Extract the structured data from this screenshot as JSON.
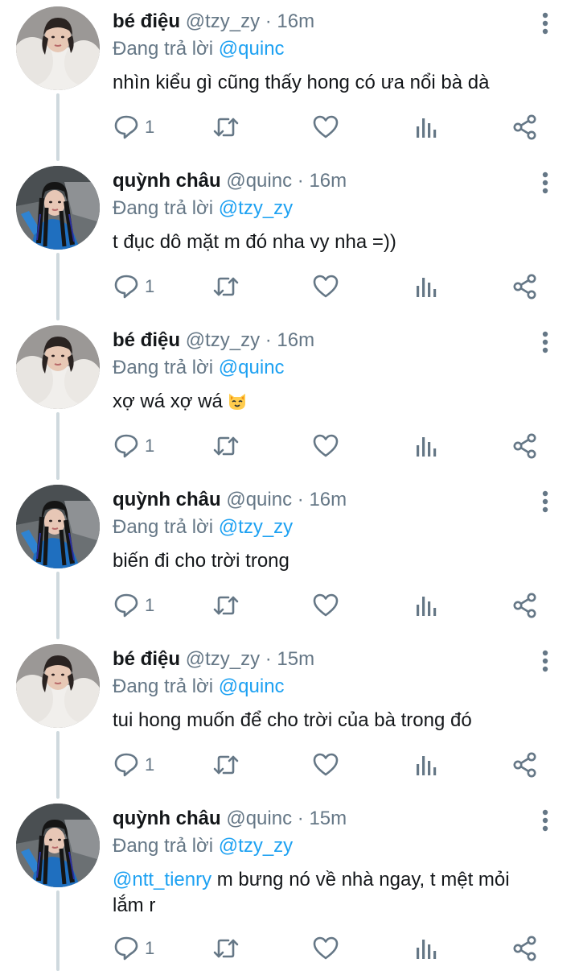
{
  "replies": [
    {
      "name": "bé điệu",
      "handle": "@tzy_zy",
      "separator": "·",
      "time": "16m",
      "replying_prefix": "Đang trả lời",
      "replying_to": "@quinc",
      "text": "nhìn kiểu gì cũng thấy hong có ưa nổi bà dà",
      "reply_count": "1",
      "avatar": "avatar-white-fur"
    },
    {
      "name": "quỳnh châu",
      "handle": "@quinc",
      "separator": "·",
      "time": "16m",
      "replying_prefix": "Đang trả lời",
      "replying_to": "@tzy_zy",
      "text": "t đục dô mặt m đó nha vy nha =))",
      "reply_count": "1",
      "avatar": "avatar-braids-blue"
    },
    {
      "name": "bé điệu",
      "handle": "@tzy_zy",
      "separator": "·",
      "time": "16m",
      "replying_prefix": "Đang trả lời",
      "replying_to": "@quinc",
      "text": "xợ wá xợ wá",
      "emoji": "cat-face-emoji",
      "reply_count": "1",
      "avatar": "avatar-white-fur"
    },
    {
      "name": "quỳnh châu",
      "handle": "@quinc",
      "separator": "·",
      "time": "16m",
      "replying_prefix": "Đang trả lời",
      "replying_to": "@tzy_zy",
      "text": "biến đi cho trời trong",
      "reply_count": "1",
      "avatar": "avatar-braids-blue"
    },
    {
      "name": "bé điệu",
      "handle": "@tzy_zy",
      "separator": "·",
      "time": "15m",
      "replying_prefix": "Đang trả lời",
      "replying_to": "@quinc",
      "text": "tui hong muốn để cho trời của bà trong đó",
      "reply_count": "1",
      "avatar": "avatar-white-fur"
    },
    {
      "name": "quỳnh châu",
      "handle": "@quinc",
      "separator": "·",
      "time": "15m",
      "replying_prefix": "Đang trả lời",
      "replying_to": "@tzy_zy",
      "text_mention": "@ntt_tienry",
      "text": " m bưng nó về nhà ngay, t mệt mỏi lắm r",
      "reply_count": "1",
      "avatar": "avatar-braids-blue"
    }
  ],
  "icons": {
    "reply": "reply-icon",
    "retweet": "retweet-icon",
    "like": "heart-icon",
    "analytics": "analytics-icon",
    "share": "share-icon",
    "more": "more-vertical-icon"
  },
  "colors": {
    "accent": "#1da1f2",
    "text": "#14171a",
    "muted": "#657786",
    "thread_line": "#cfd9de"
  }
}
